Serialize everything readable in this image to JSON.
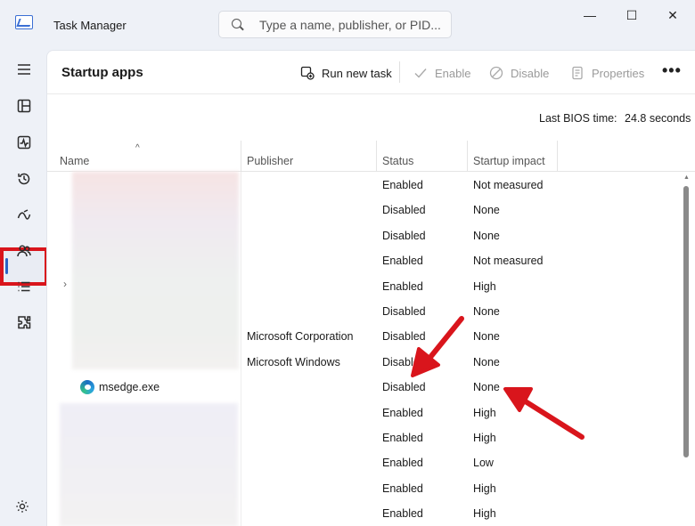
{
  "window": {
    "title": "Task Manager",
    "minimize_glyph": "—",
    "maximize_glyph": "☐",
    "close_glyph": "✕"
  },
  "search": {
    "placeholder": "Type a name, publisher, or PID..."
  },
  "sidebar": {
    "items": [
      {
        "name": "hamburger-menu-icon"
      },
      {
        "name": "processes-icon"
      },
      {
        "name": "performance-icon"
      },
      {
        "name": "app-history-icon"
      },
      {
        "name": "startup-apps-icon",
        "active": true
      },
      {
        "name": "users-icon"
      },
      {
        "name": "details-icon"
      },
      {
        "name": "services-icon"
      }
    ],
    "settings_icon": "gear-icon"
  },
  "page": {
    "title": "Startup apps",
    "toolbar": {
      "run_new_task": "Run new task",
      "enable": "Enable",
      "disable": "Disable",
      "properties": "Properties",
      "more": "•••"
    },
    "bios_label": "Last BIOS time:",
    "bios_value": "24.8 seconds"
  },
  "table": {
    "sort_indicator": "^",
    "expander_glyph": "›",
    "columns": {
      "name": "Name",
      "publisher": "Publisher",
      "status": "Status",
      "impact": "Startup impact"
    },
    "rows": [
      {
        "name": "",
        "publisher": "",
        "status": "Enabled",
        "impact": "Not measured"
      },
      {
        "name": "",
        "publisher": "",
        "status": "Disabled",
        "impact": "None"
      },
      {
        "name": "",
        "publisher": "",
        "status": "Disabled",
        "impact": "None"
      },
      {
        "name": "",
        "publisher": "",
        "status": "Enabled",
        "impact": "Not measured"
      },
      {
        "name": "",
        "publisher": "",
        "status": "Enabled",
        "impact": "High"
      },
      {
        "name": "",
        "publisher": "",
        "status": "Disabled",
        "impact": "None"
      },
      {
        "name": "",
        "publisher": "Microsoft Corporation",
        "status": "Disabled",
        "impact": "None"
      },
      {
        "name": "",
        "publisher": "Microsoft Windows",
        "status": "Disable",
        "impact": "None"
      },
      {
        "name": "msedge.exe",
        "publisher": "",
        "status": "Disabled",
        "impact": "None"
      },
      {
        "name": "",
        "publisher": "",
        "status": "Enabled",
        "impact": "High"
      },
      {
        "name": "",
        "publisher": "",
        "status": "Enabled",
        "impact": "High"
      },
      {
        "name": "",
        "publisher": "",
        "status": "Enabled",
        "impact": "Low"
      },
      {
        "name": "",
        "publisher": "",
        "status": "Enabled",
        "impact": "High"
      },
      {
        "name": "",
        "publisher": "",
        "status": "Enabled",
        "impact": "High"
      }
    ]
  },
  "colors": {
    "annotation": "#d9151c",
    "accent": "#2a64c5"
  }
}
